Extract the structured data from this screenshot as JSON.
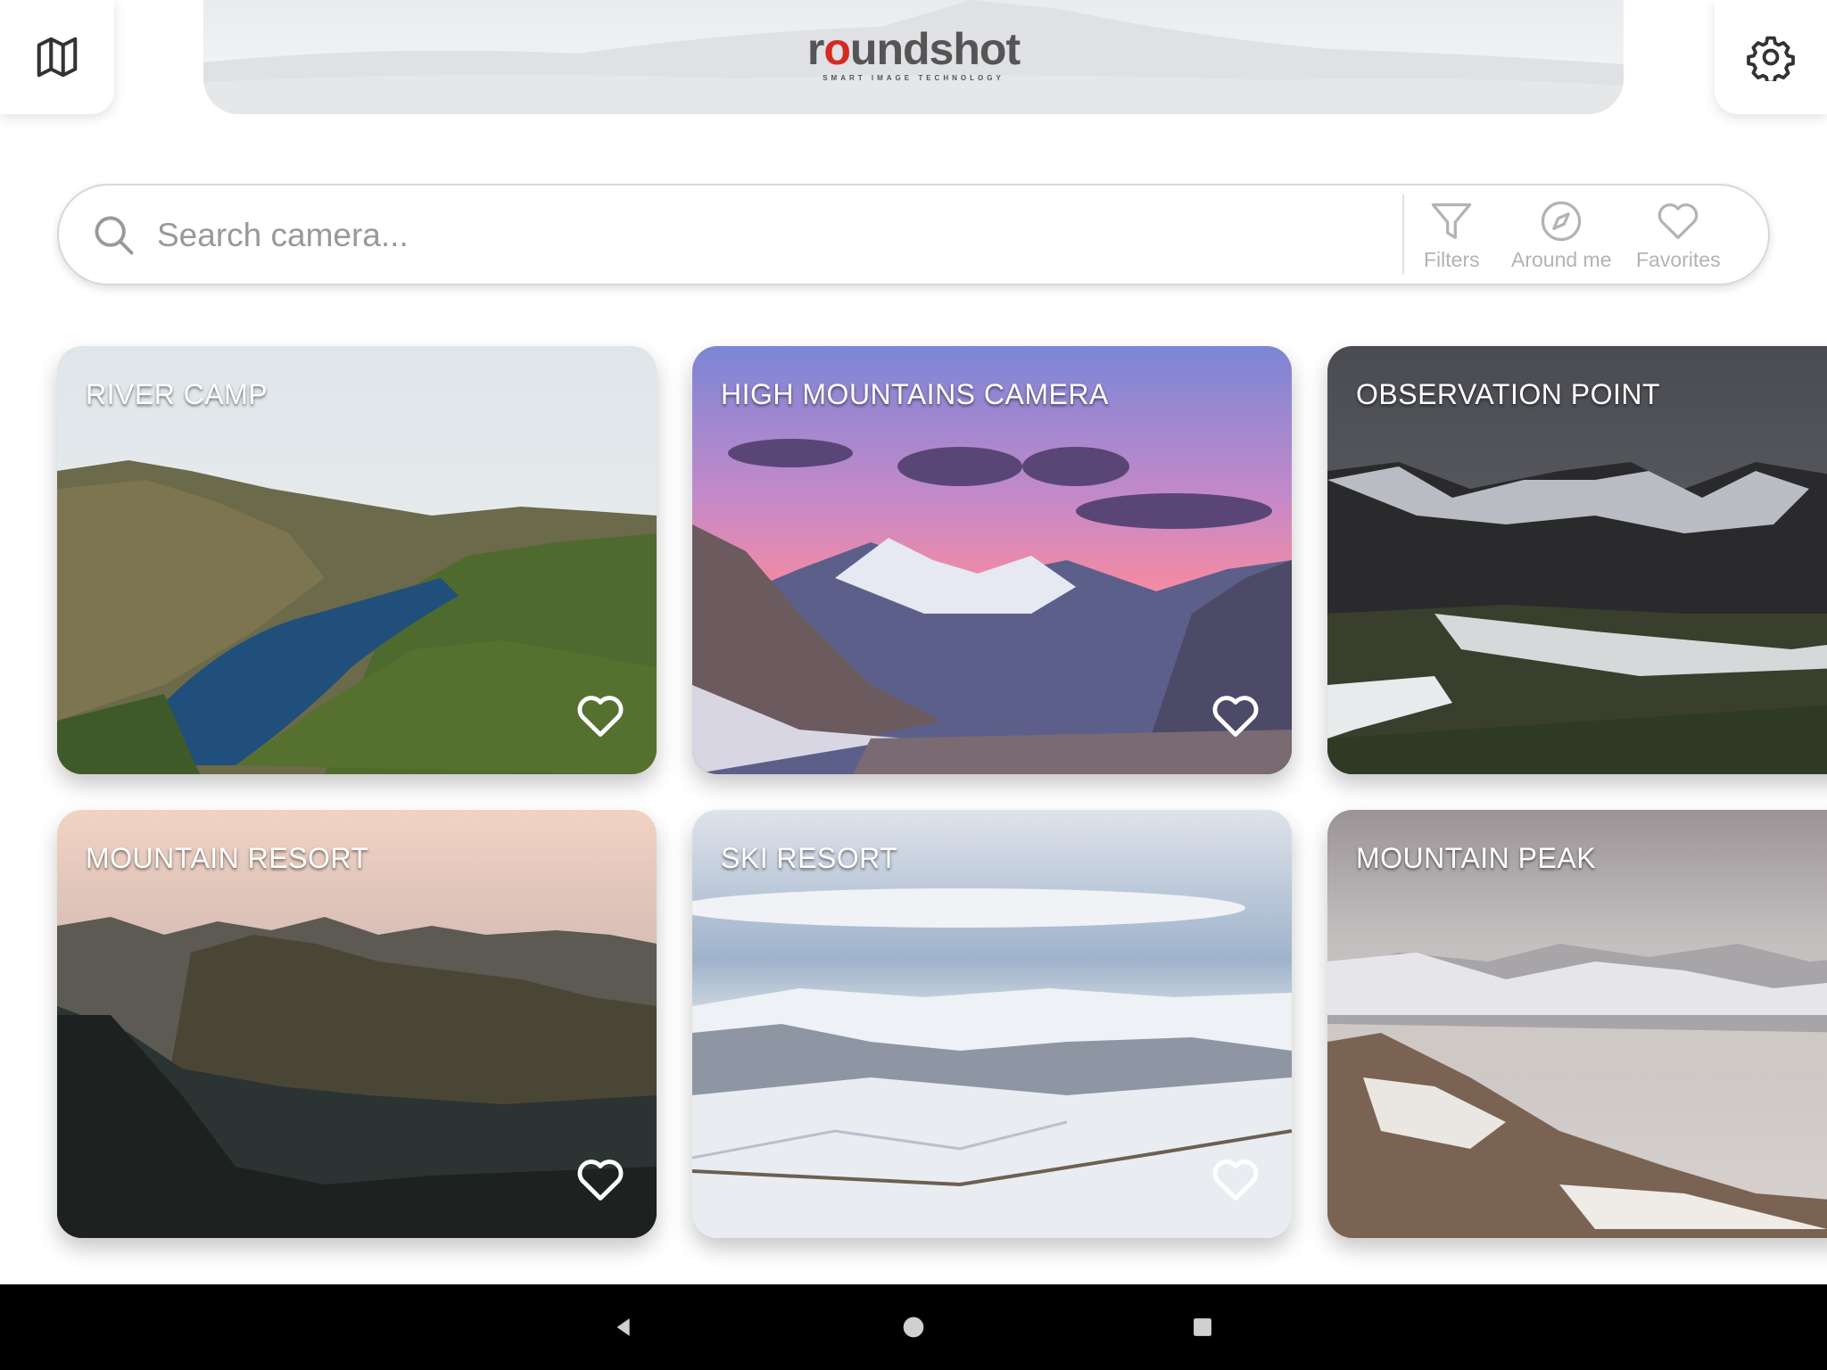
{
  "header": {
    "map_icon": "map-icon",
    "settings_icon": "gear-icon",
    "logo": {
      "word_part1": "r",
      "word_o": "o",
      "word_part2": "undshot",
      "tagline": "SMART IMAGE TECHNOLOGY"
    }
  },
  "search": {
    "placeholder": "Search camera...",
    "value": "",
    "tools": [
      {
        "icon": "filter-icon",
        "label": "Filters"
      },
      {
        "icon": "compass-icon",
        "label": "Around me"
      },
      {
        "icon": "heart-icon",
        "label": "Favorites"
      }
    ]
  },
  "cameras": [
    {
      "title": "RIVER CAMP",
      "favorite": false
    },
    {
      "title": "HIGH MOUNTAINS CAMERA",
      "favorite": false
    },
    {
      "title": "OBSERVATION POINT",
      "favorite": false
    },
    {
      "title": "MOUNTAIN RESORT",
      "favorite": false
    },
    {
      "title": "SKI RESORT",
      "favorite": false
    },
    {
      "title": "MOUNTAIN PEAK",
      "favorite": false
    }
  ],
  "colors": {
    "brand_red": "#d42a20",
    "tool_gray": "#b3b3b3",
    "navbar": "#000000"
  },
  "system_nav": {
    "back_icon": "back-triangle-icon",
    "home_icon": "home-circle-icon",
    "recents_icon": "recents-square-icon"
  }
}
